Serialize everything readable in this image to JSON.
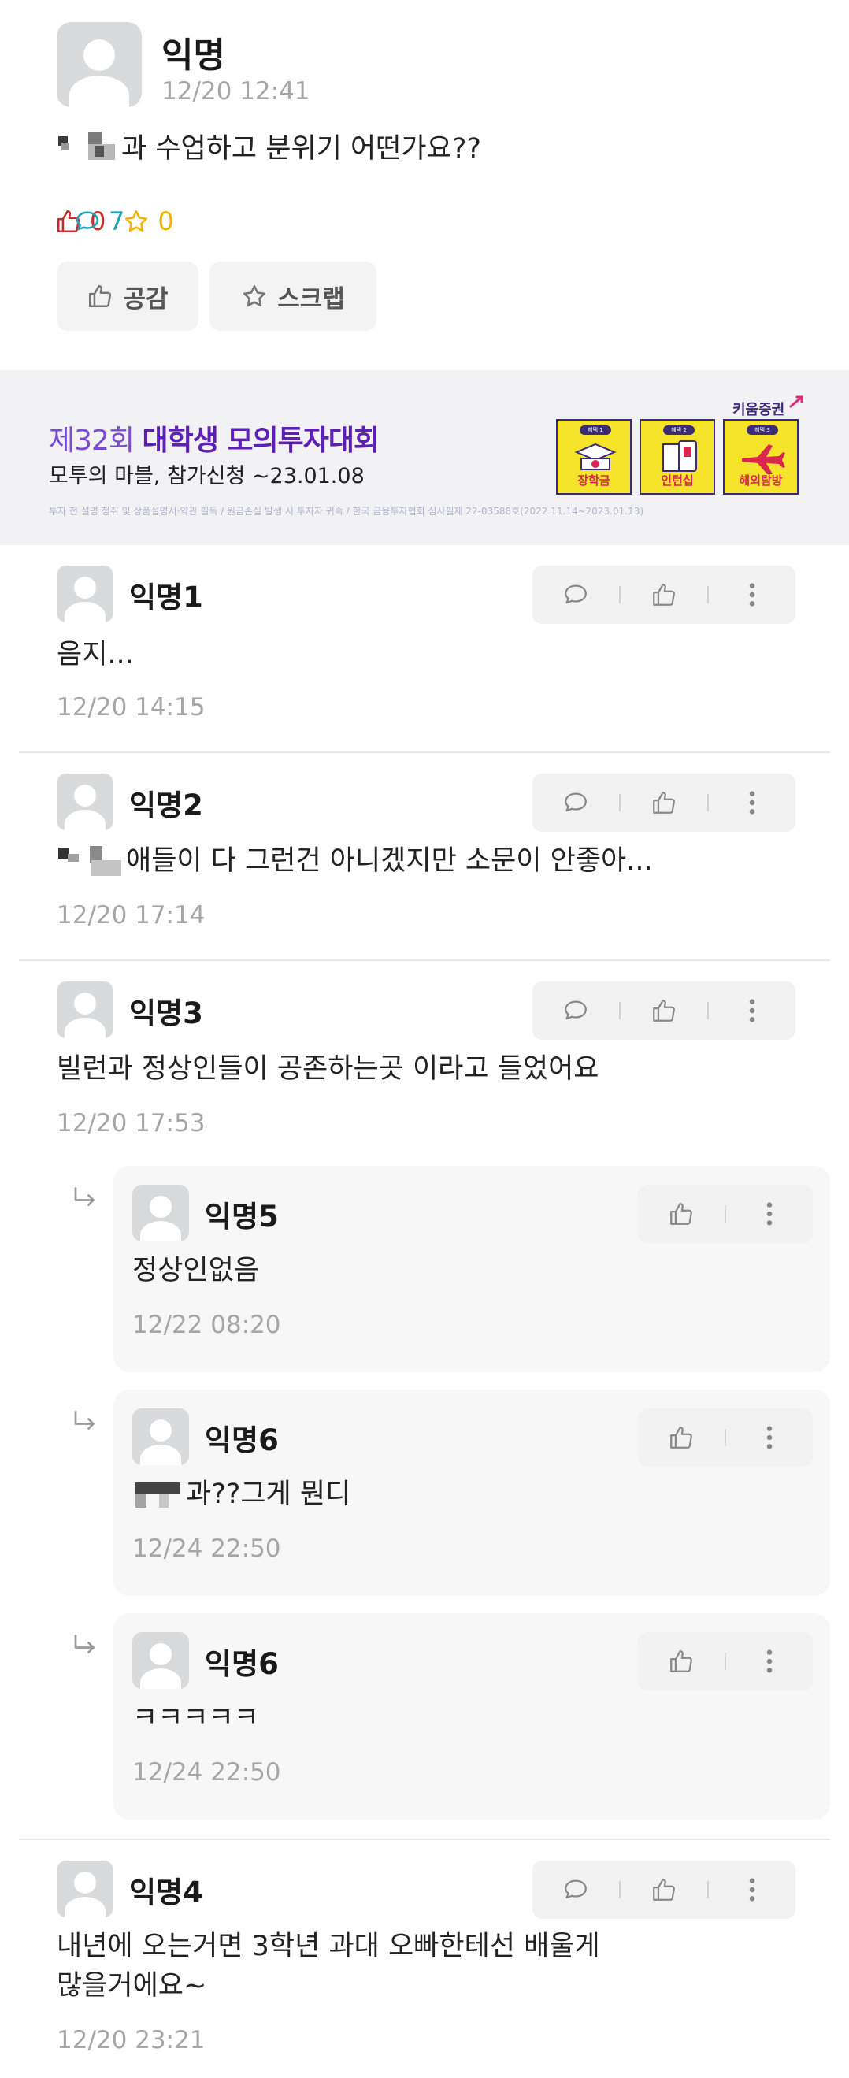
{
  "post": {
    "author": "익명",
    "time": "12/20 12:41",
    "text": "과 수업하고 분위기 어떤가요??",
    "likes": "0",
    "comments": "7",
    "scraps": "0",
    "like_button": "공감",
    "scrap_button": "스크랩",
    "colors": {
      "like": "#c62e2e",
      "comment": "#1fa3b3",
      "scrap": "#f0b400"
    }
  },
  "ad": {
    "title_prefix": "제32회",
    "title_main": "대학생 모의투자대회",
    "subtitle": "모투의 마블, 참가신청 ~23.01.08",
    "fine_print": "투자 전 설명 청취 및 상품설명서·약관 필독 / 원금손실 발생 시 투자자 귀속 / 한국 금융투자협회 심사필제 22-03588호(2022.11.14~2023.01.13)",
    "brand": "키움증권",
    "tiles": [
      {
        "tab": "혜택 1",
        "label": "장학금"
      },
      {
        "tab": "혜택 2",
        "label": "인턴십"
      },
      {
        "tab": "혜택 3",
        "label": "해외탐방"
      }
    ]
  },
  "comments": [
    {
      "author": "익명1",
      "text": "음지...",
      "time": "12/20 14:15"
    },
    {
      "author": "익명2",
      "text": "애들이 다 그런건 아니겠지만 소문이 안좋아...",
      "time": "12/20 17:14"
    },
    {
      "author": "익명3",
      "text": "빌런과 정상인들이 공존하는곳 이라고 들었어요",
      "time": "12/20 17:53"
    },
    {
      "author": "익명4",
      "text_line1": "내년에 오는거면 3학년 과대 오빠한테선 배울게",
      "text_line2": "많을거에요~",
      "time": "12/20 23:21"
    }
  ],
  "replies": [
    {
      "author": "익명5",
      "text": "정상인없음",
      "time": "12/22 08:20"
    },
    {
      "author": "익명6",
      "text": "과??그게 뭔디",
      "time": "12/24 22:50"
    },
    {
      "author": "익명6",
      "text": "ㅋㅋㅋㅋㅋ",
      "time": "12/24 22:50"
    }
  ],
  "icons": {
    "like": "thumbs-up-icon",
    "comment": "speech-bubble-icon",
    "scrap": "star-icon",
    "more": "more-vertical-icon",
    "reply": "reply-arrow-icon"
  }
}
